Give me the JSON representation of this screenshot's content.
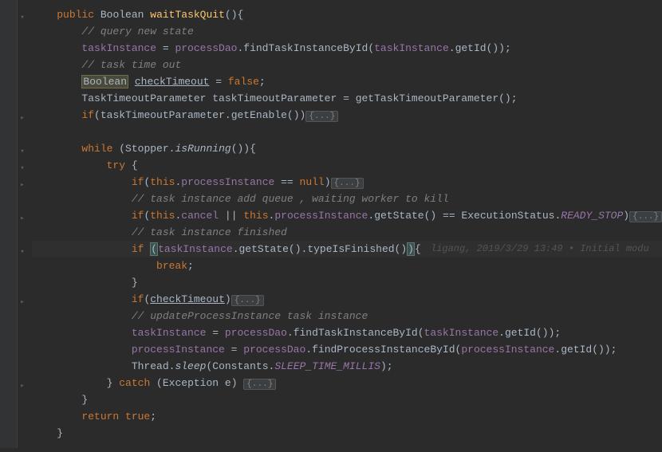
{
  "gutter": {},
  "annotation": {
    "text": "ligang, 2019/3/29 13:49 • Initial modu"
  },
  "fold": {
    "ellipsis": "{...}"
  },
  "code": {
    "l1": {
      "kw_public": "public",
      "type": "Boolean",
      "method": "waitTaskQuit",
      "parens": "(){"
    },
    "l2": {
      "comment": "// query new state"
    },
    "l3": {
      "a": "taskInstance",
      "eq": " = ",
      "b": "processDao",
      "dot": ".",
      "m": "findTaskInstanceById",
      "c": "taskInstance",
      "m2": "getId",
      "end": "());"
    },
    "l4": {
      "comment": "// task time out"
    },
    "l5": {
      "type": "Boolean",
      "var": "checkTimeout",
      "eq": " = ",
      "val": "false",
      "semi": ";"
    },
    "l6": {
      "t1": "TaskTimeoutParameter ",
      "v": "taskTimeoutParameter",
      "eq": " = ",
      "m": "getTaskTimeoutParameter",
      "end": "();"
    },
    "l7": {
      "kw": "if",
      "p": "(",
      "v": "taskTimeoutParameter",
      "dot": ".",
      "m": "getEnable",
      "p2": "())"
    },
    "l8": {},
    "l9": {
      "kw": "while",
      "p": " (",
      "c": "Stopper",
      "dot": ".",
      "m": "isRunning",
      "p2": "()){"
    },
    "l10": {
      "kw": "try",
      "b": " {"
    },
    "l11": {
      "kw": "if",
      "p": "(",
      "this": "this",
      "dot": ".",
      "f": "processInstance",
      "eq": " == ",
      "null": "null",
      "p2": ")"
    },
    "l12": {
      "comment": "// task instance add queue , waiting worker to kill"
    },
    "l13": {
      "kw": "if",
      "p": "(",
      "this": "this",
      "d": ".",
      "f": "cancel",
      "or": " || ",
      "this2": "this",
      "d2": ".",
      "f2": "processInstance",
      "d3": ".",
      "m": "getState",
      "p2": "() == ",
      "c": "ExecutionStatus",
      "d4": ".",
      "cn": "READY_STOP",
      "p3": ")"
    },
    "l14": {
      "comment": "// task instance finished"
    },
    "l15": {
      "kw": "if",
      "sp": " ",
      "p": "(",
      "v": "taskInstance",
      "d": ".",
      "m": "getState",
      "p2": "().",
      "m2": "typeIsFinished",
      "p3": "()",
      "p4": ")",
      "b": "{"
    },
    "l16": {
      "kw": "break",
      "semi": ";"
    },
    "l17": {
      "b": "}"
    },
    "l18": {
      "kw": "if",
      "p": "(",
      "v": "checkTimeout",
      "p2": ")"
    },
    "l19": {
      "comment": "// updateProcessInstance task instance"
    },
    "l20": {
      "a": "taskInstance",
      "eq": " = ",
      "b": "processDao",
      "d": ".",
      "m": "findTaskInstanceById",
      "p": "(",
      "c": "taskInstance",
      "d2": ".",
      "m2": "getId",
      "p2": "());"
    },
    "l21": {
      "a": "processInstance",
      "eq": " = ",
      "b": "processDao",
      "d": ".",
      "m": "findProcessInstanceById",
      "p": "(",
      "c": "processInstance",
      "d2": ".",
      "m2": "getId",
      "p2": "());"
    },
    "l22": {
      "c": "Thread",
      "d": ".",
      "m": "sleep",
      "p": "(",
      "c2": "Constants",
      "d2": ".",
      "cn": "SLEEP_TIME_MILLIS",
      "p2": ");"
    },
    "l23": {
      "b": "} ",
      "kw": "catch",
      "p": " (",
      "t": "Exception ",
      "v": "e",
      "p2": ") "
    },
    "l24": {
      "b": "}"
    },
    "l25": {
      "kw": "return ",
      "val": "true",
      "semi": ";"
    },
    "l26": {
      "b": "}"
    }
  }
}
